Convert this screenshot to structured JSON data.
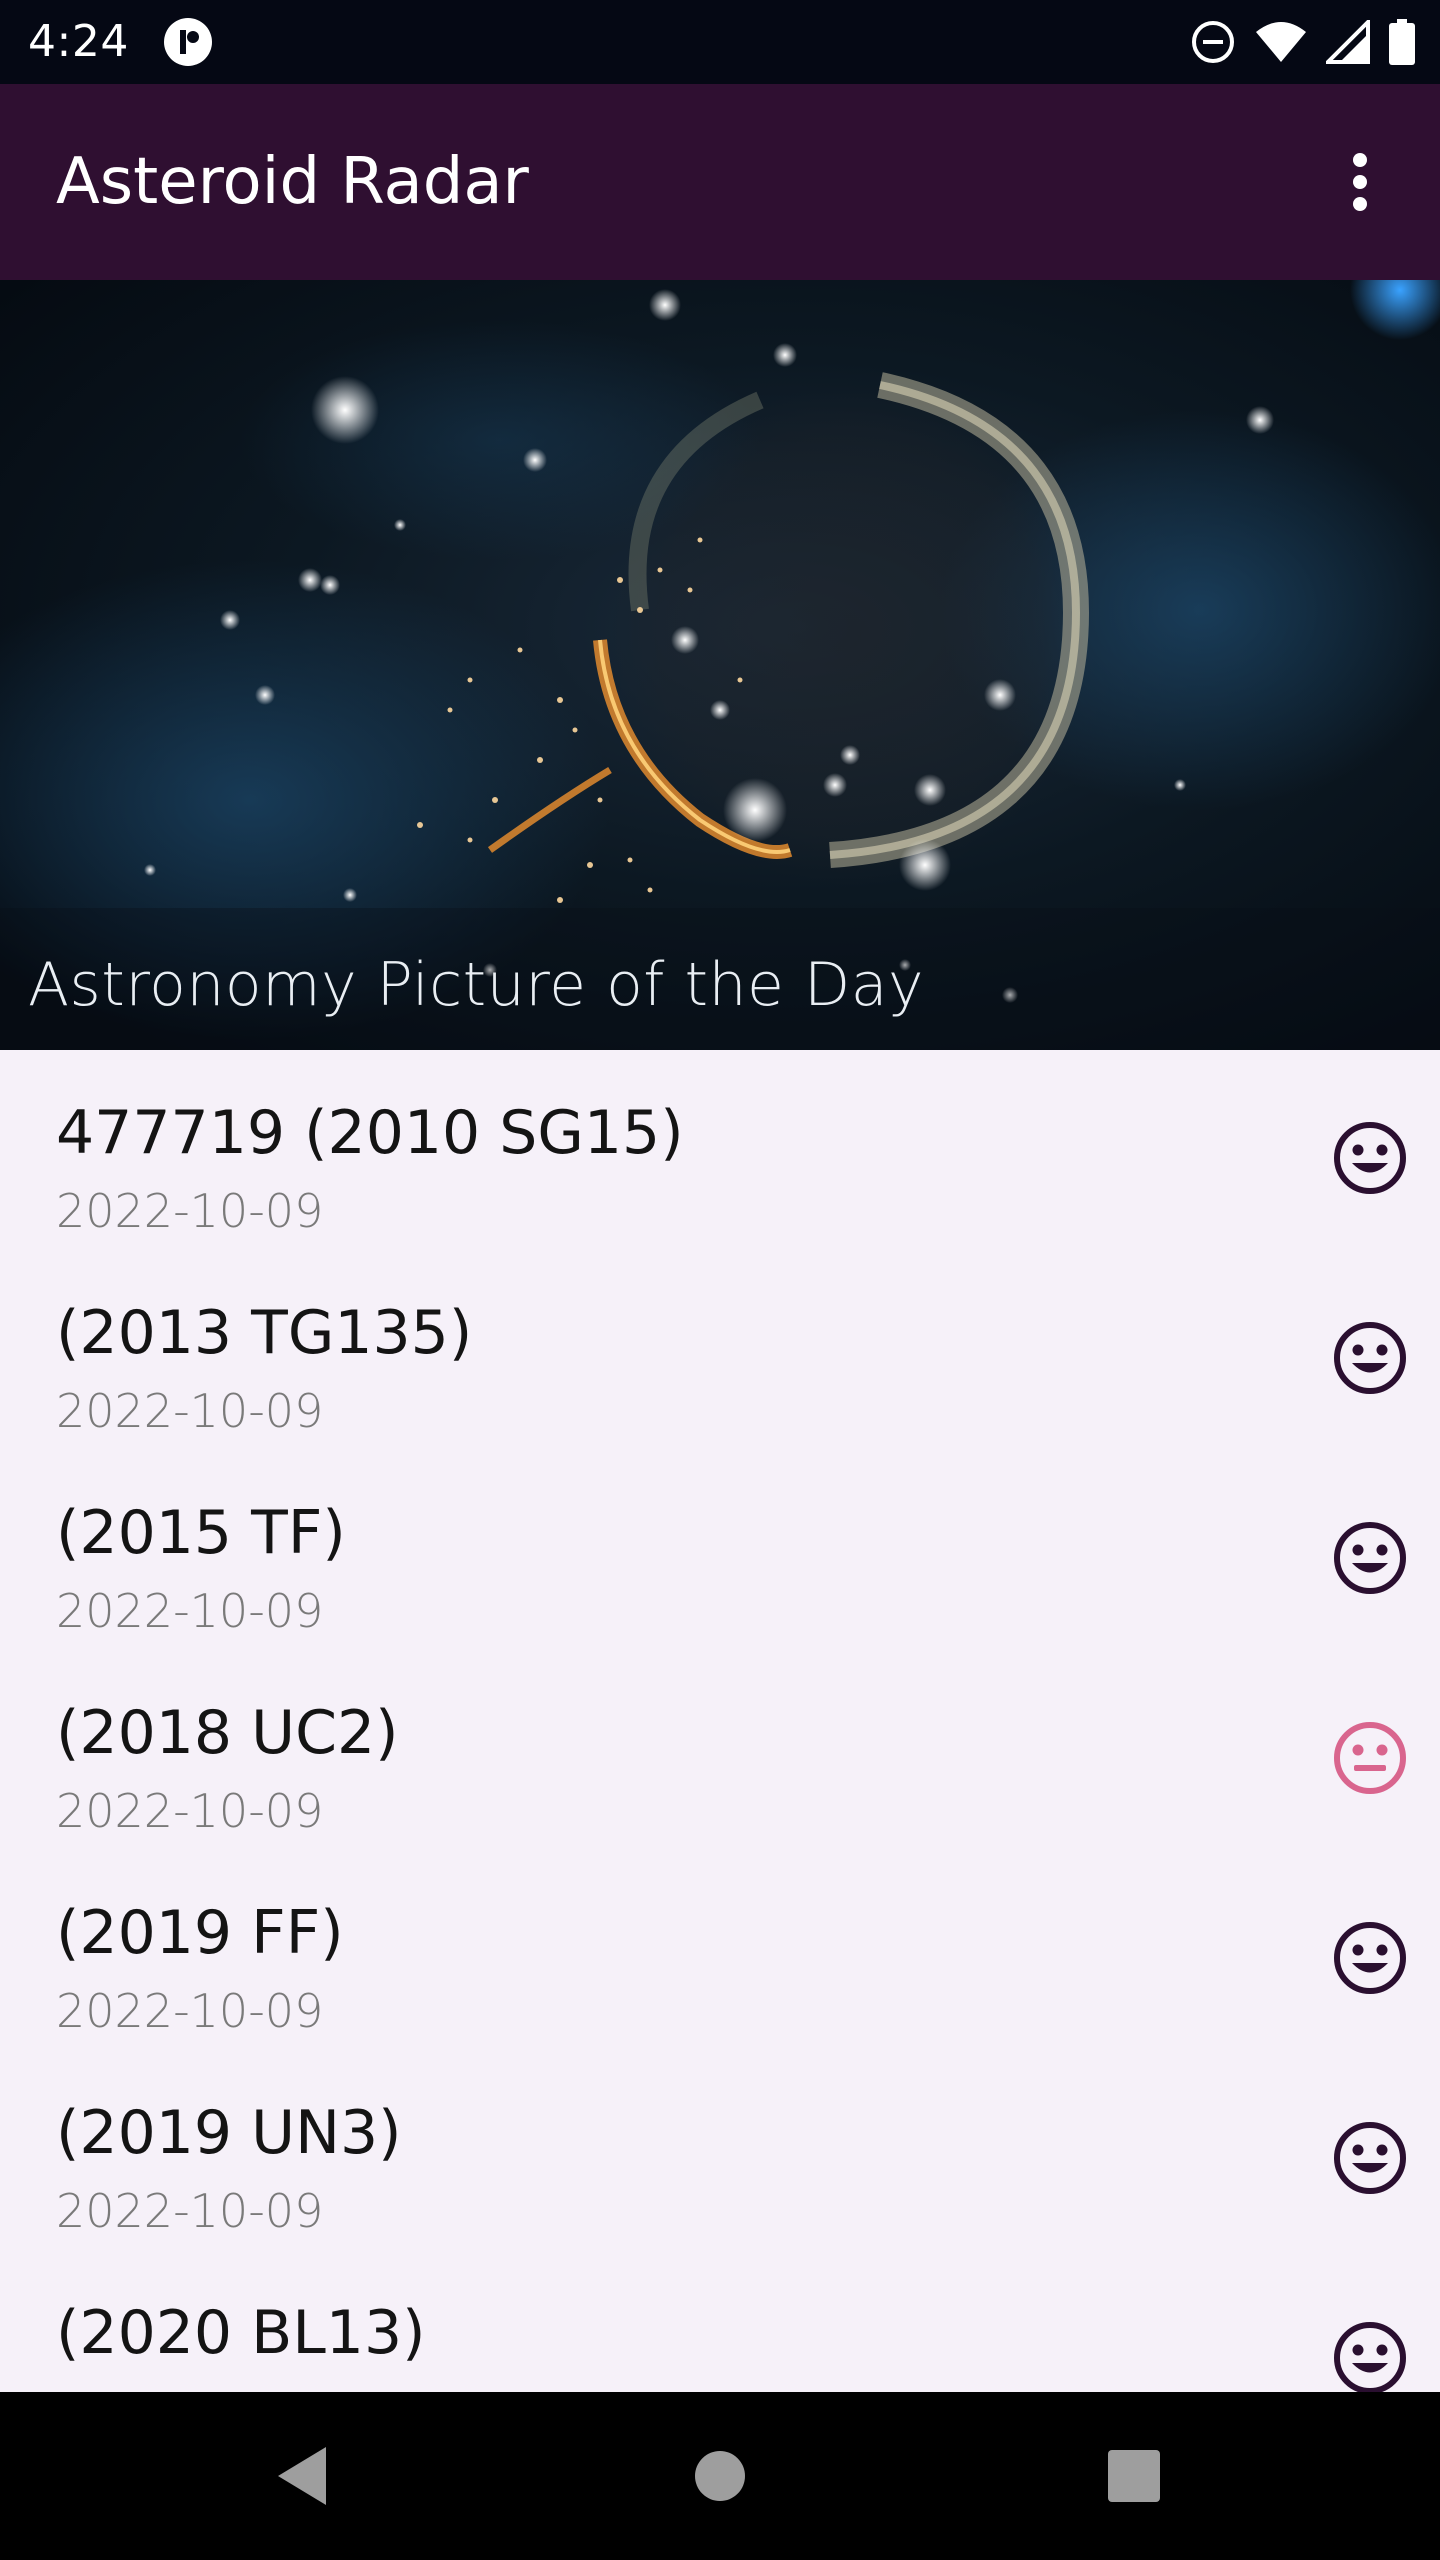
{
  "status_bar": {
    "time": "4:24",
    "icons": [
      "app-notification-icon",
      "do-not-disturb-icon",
      "wifi-icon",
      "signal-icon",
      "battery-icon"
    ]
  },
  "app_bar": {
    "title": "Asteroid Radar",
    "menu_icon": "more-vert-icon"
  },
  "hero": {
    "caption": "Astronomy Picture of the Day"
  },
  "asteroids": [
    {
      "name": "477719 (2010 SG15)",
      "date": "2022-10-09",
      "status_icon": "happy-face-icon",
      "potentially_hazardous": false
    },
    {
      "name": "(2013 TG135)",
      "date": "2022-10-09",
      "status_icon": "happy-face-icon",
      "potentially_hazardous": false
    },
    {
      "name": "(2015 TF)",
      "date": "2022-10-09",
      "status_icon": "happy-face-icon",
      "potentially_hazardous": false
    },
    {
      "name": "(2018 UC2)",
      "date": "2022-10-09",
      "status_icon": "neutral-face-icon",
      "potentially_hazardous": true
    },
    {
      "name": "(2019 FF)",
      "date": "2022-10-09",
      "status_icon": "happy-face-icon",
      "potentially_hazardous": false
    },
    {
      "name": "(2019 UN3)",
      "date": "2022-10-09",
      "status_icon": "happy-face-icon",
      "potentially_hazardous": false
    },
    {
      "name": "(2020 BL13)",
      "date": "",
      "status_icon": "happy-face-icon",
      "potentially_hazardous": false
    }
  ],
  "colors": {
    "app_bar": "#2f0f31",
    "list_background": "#f6f1f9",
    "safe_icon": "#2a0f30",
    "hazard_icon": "#d9658e"
  },
  "nav_bar": {
    "buttons": [
      "back-icon",
      "home-icon",
      "recents-icon"
    ]
  }
}
